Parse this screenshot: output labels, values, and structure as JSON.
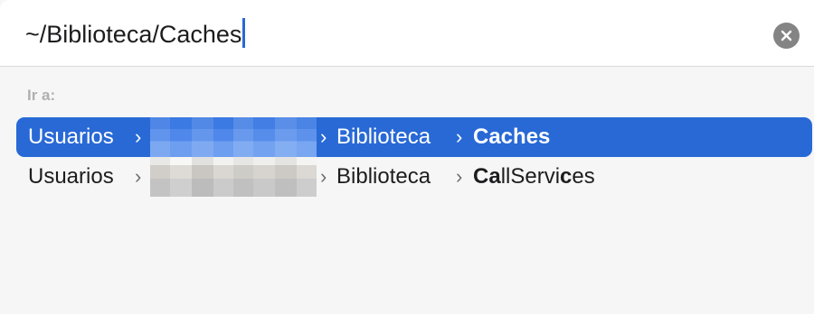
{
  "search": {
    "value": "~/Biblioteca/Caches",
    "clear_icon": "x-mark-icon"
  },
  "section": {
    "label": "Ir a:"
  },
  "results": [
    {
      "root": "Usuarios",
      "separator": "›",
      "library": "Biblioteca",
      "leaf": "Caches",
      "selected": true
    },
    {
      "root": "Usuarios",
      "separator": "›",
      "library": "Biblioteca",
      "leaf_parts": [
        "C",
        "a",
        "llServi",
        "c",
        "es"
      ],
      "leaf": "CallServices",
      "selected": false
    }
  ],
  "colors": {
    "accent": "#2869d6",
    "clear_button": "#848484",
    "section_label": "#b0b0b0"
  },
  "icons": {
    "separator": "chevron-right-icon",
    "user_name": "pixelated-username"
  }
}
